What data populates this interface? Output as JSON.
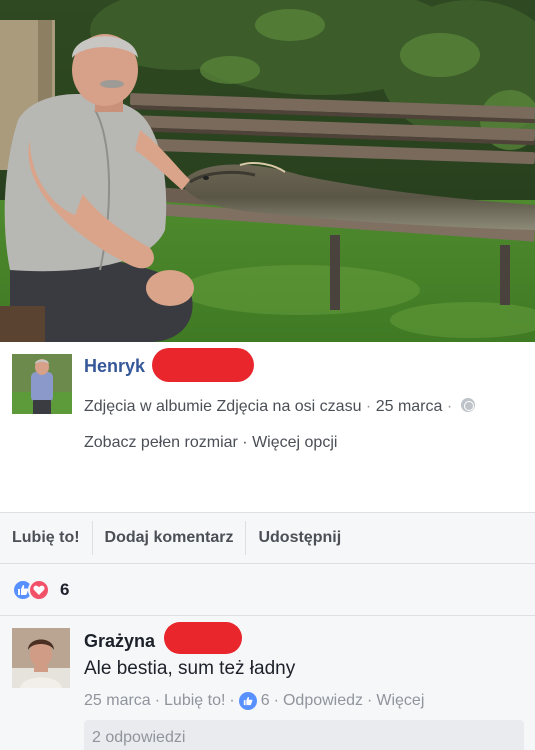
{
  "post": {
    "owner_name": "Henryk",
    "album_prefix": "Zdjęcia w albumie",
    "album_name": "Zdjęcia na osi czasu",
    "date": "25 marca",
    "view_full": "Zobacz pełen rozmiar",
    "more_options": "Więcej opcji",
    "separator": " · "
  },
  "actions": {
    "like": "Lubię to!",
    "comment": "Dodaj komentarz",
    "share": "Udostępnij"
  },
  "reactions": {
    "count": "6",
    "types": [
      "like-icon",
      "love-icon"
    ]
  },
  "comment": {
    "author": "Grażyna",
    "text": "Ale bestia, sum też ładny",
    "date": "25 marca",
    "like": "Lubię to!",
    "like_count": "6",
    "reply": "Odpowiedz",
    "more": "Więcej",
    "replies": "2 odpowiedzi"
  },
  "colors": {
    "link_blue": "#365899",
    "like_blue": "#5890ff",
    "love_red": "#f25268",
    "redaction_red": "#e8262c",
    "bar_gray": "#f6f7f9"
  }
}
